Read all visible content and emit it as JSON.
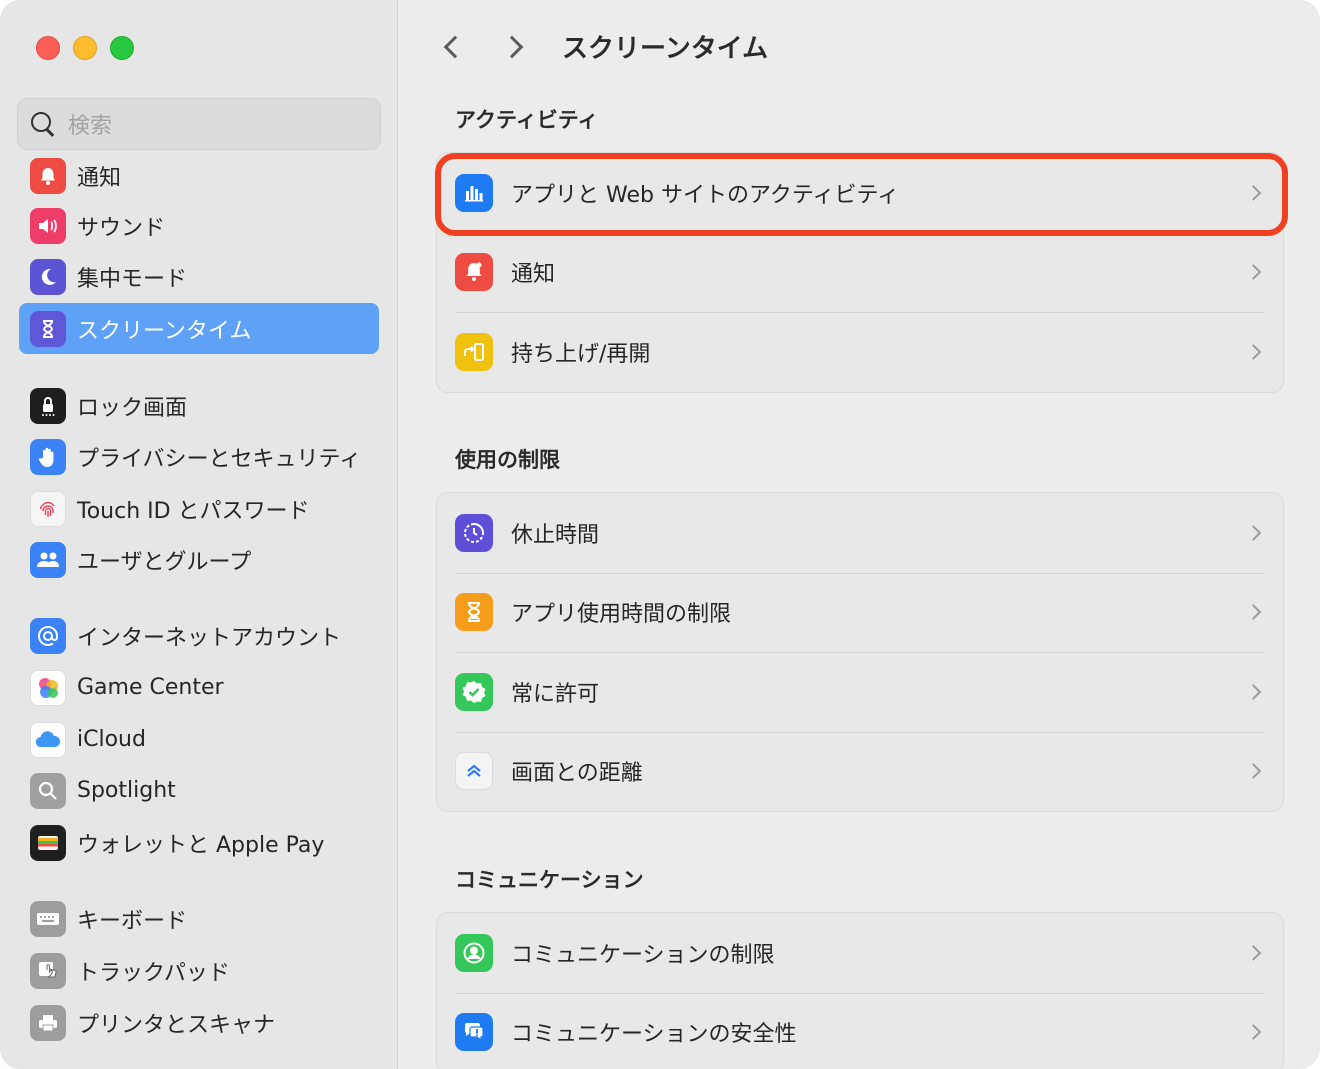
{
  "sidebar": {
    "search_placeholder": "検索",
    "items": [
      {
        "label": "通知",
        "icon": "bell-icon",
        "color": "#ee4c42"
      },
      {
        "label": "サウンド",
        "icon": "speaker-icon",
        "color": "#ef3d6a"
      },
      {
        "label": "集中モード",
        "icon": "moon-icon",
        "color": "#5b55d6"
      },
      {
        "label": "スクリーンタイム",
        "icon": "hourglass-icon",
        "color": "#6057d8"
      },
      {
        "label": "ロック画面",
        "icon": "lock-icon",
        "color": "#1f1f1f"
      },
      {
        "label": "プライバシーとセキュリティ",
        "icon": "hand-icon",
        "color": "#3b82f6"
      },
      {
        "label": "Touch ID とパスワード",
        "icon": "fingerprint-icon",
        "color": "#f6f6f6"
      },
      {
        "label": "ユーザとグループ",
        "icon": "users-icon",
        "color": "#3b82f6"
      },
      {
        "label": "インターネットアカウント",
        "icon": "at-icon",
        "color": "#3b82f6"
      },
      {
        "label": "Game Center",
        "icon": "game-center-icon",
        "color": "#ffffff"
      },
      {
        "label": "iCloud",
        "icon": "cloud-icon",
        "color": "#ffffff"
      },
      {
        "label": "Spotlight",
        "icon": "magnifier-icon",
        "color": "#a0a0a0"
      },
      {
        "label": "ウォレットと Apple Pay",
        "icon": "wallet-icon",
        "color": "#1f1f1f"
      },
      {
        "label": "キーボード",
        "icon": "keyboard-icon",
        "color": "#9d9d9d"
      },
      {
        "label": "トラックパッド",
        "icon": "trackpad-icon",
        "color": "#9d9d9d"
      },
      {
        "label": "プリンタとスキャナ",
        "icon": "printer-icon",
        "color": "#9d9d9d"
      }
    ],
    "selected": "スクリーンタイム"
  },
  "main": {
    "title": "スクリーンタイム",
    "sections": [
      {
        "title": "アクティビティ",
        "rows": [
          {
            "label": "アプリと Web サイトのアクティビティ",
            "icon": "chart-bars-icon",
            "color": "#1e7bf2"
          },
          {
            "label": "通知",
            "icon": "bell-icon",
            "color": "#ee4c42"
          },
          {
            "label": "持ち上げ/再開",
            "icon": "phone-pickup-icon",
            "color": "#f0c10e"
          }
        ]
      },
      {
        "title": "使用の制限",
        "rows": [
          {
            "label": "休止時間",
            "icon": "downtime-icon",
            "color": "#5f4fd8"
          },
          {
            "label": "アプリ使用時間の制限",
            "icon": "hourglass-icon",
            "color": "#f59c1a"
          },
          {
            "label": "常に許可",
            "icon": "checkmark-badge-icon",
            "color": "#34c759"
          },
          {
            "label": "画面との距離",
            "icon": "distance-icon",
            "color": "#f4f4f4"
          }
        ]
      },
      {
        "title": "コミュニケーション",
        "rows": [
          {
            "label": "コミュニケーションの制限",
            "icon": "contact-icon",
            "color": "#34c759"
          },
          {
            "label": "コミュニケーションの安全性",
            "icon": "chat-bubble-icon",
            "color": "#1e7bf2"
          }
        ]
      }
    ],
    "highlight_color": "#f0401f"
  }
}
